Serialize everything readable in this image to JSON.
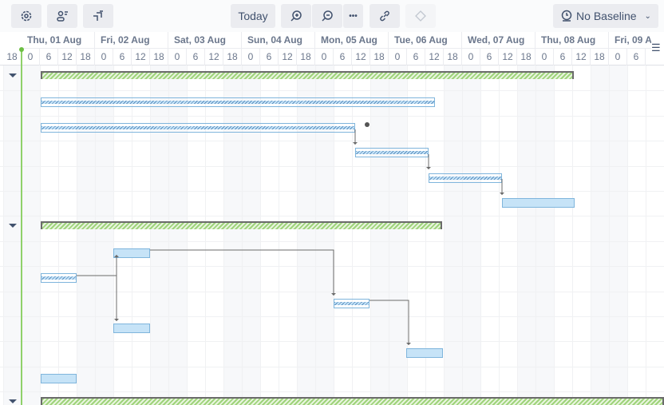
{
  "toolbar": {
    "settings_icon": "gear-icon",
    "resources_icon": "user-list-icon",
    "critical_path_icon": "steps-icon",
    "today_label": "Today",
    "zoom_in_icon": "zoom-in-icon",
    "zoom_out_icon": "zoom-out-icon",
    "more_label": "•••",
    "link_icon": "link-icon",
    "milestone_icon": "diamond-icon",
    "baseline_label": "No Baseline"
  },
  "timeline": {
    "days": [
      "Thu, 01 Aug",
      "Fri, 02 Aug",
      "Sat, 03 Aug",
      "Sun, 04 Aug",
      "Mon, 05 Aug",
      "Tue, 06 Aug",
      "Wed, 07 Aug",
      "Thu, 08 Aug",
      "Fri, 09 A"
    ],
    "hours": [
      "18",
      "0",
      "6",
      "12",
      "18",
      "0",
      "6",
      "12",
      "18",
      "0",
      "6",
      "12",
      "18",
      "0",
      "6",
      "12",
      "18",
      "0",
      "6",
      "12",
      "18",
      "0",
      "6",
      "12",
      "18",
      "0",
      "6",
      "12",
      "18",
      "0",
      "6",
      "12",
      "18",
      "0",
      "6"
    ]
  }
}
